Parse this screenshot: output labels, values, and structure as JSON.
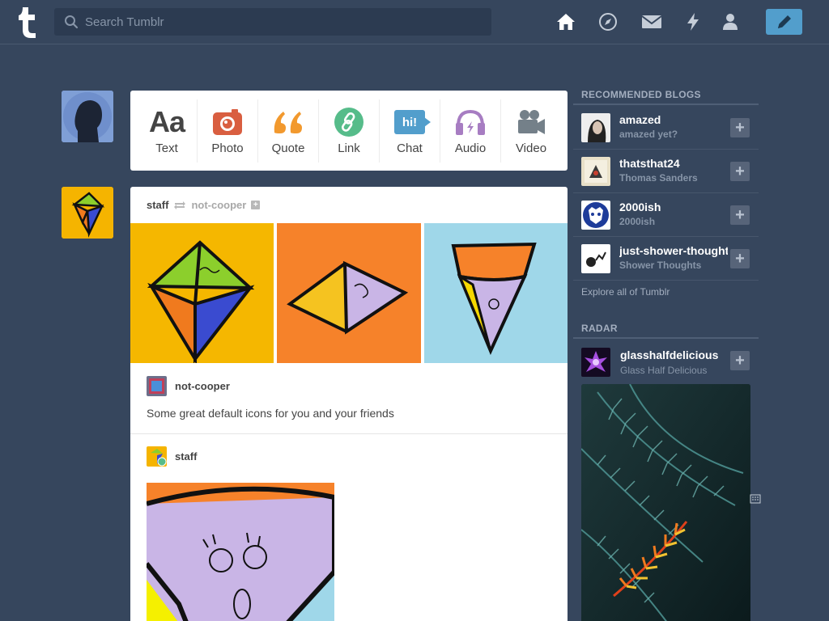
{
  "header": {
    "search_placeholder": "Search Tumblr",
    "nav": [
      "home-icon",
      "explore-icon",
      "inbox-icon",
      "activity-icon",
      "account-icon"
    ],
    "compose_icon": "pencil-icon"
  },
  "post_types": [
    {
      "label": "Text",
      "icon": "Aa",
      "color": "#444444"
    },
    {
      "label": "Photo",
      "icon": "camera-icon",
      "color": "#d95e40"
    },
    {
      "label": "Quote",
      "icon": "quote-icon",
      "color": "#f2992e"
    },
    {
      "label": "Link",
      "icon": "link-icon",
      "color": "#56bc8a"
    },
    {
      "label": "Chat",
      "icon": "hi!",
      "color": "#529ecc"
    },
    {
      "label": "Audio",
      "icon": "headphones-icon",
      "color": "#a77dc2"
    },
    {
      "label": "Video",
      "icon": "video-camera-icon",
      "color": "#748089"
    }
  ],
  "post": {
    "author": "staff",
    "reblogged_from": "not-cooper",
    "reblog_author": "not-cooper",
    "reblog_text": "Some great default icons for you and your friends",
    "staff_name": "staff"
  },
  "sidebar": {
    "recommended_title": "RECOMMENDED BLOGS",
    "blogs": [
      {
        "name": "amazed",
        "sub": "amazed yet?"
      },
      {
        "name": "thatsthat24",
        "sub": "Thomas Sanders"
      },
      {
        "name": "2000ish",
        "sub": "2000ish"
      },
      {
        "name": "just-shower-thoughts",
        "sub": "Shower Thoughts"
      }
    ],
    "explore_link": "Explore all of Tumblr",
    "radar_title": "RADAR",
    "radar": {
      "name": "glasshalfdelicious",
      "sub": "Glass Half Delicious"
    }
  },
  "colors": {
    "background": "#36465d",
    "accent": "#529ecc"
  }
}
